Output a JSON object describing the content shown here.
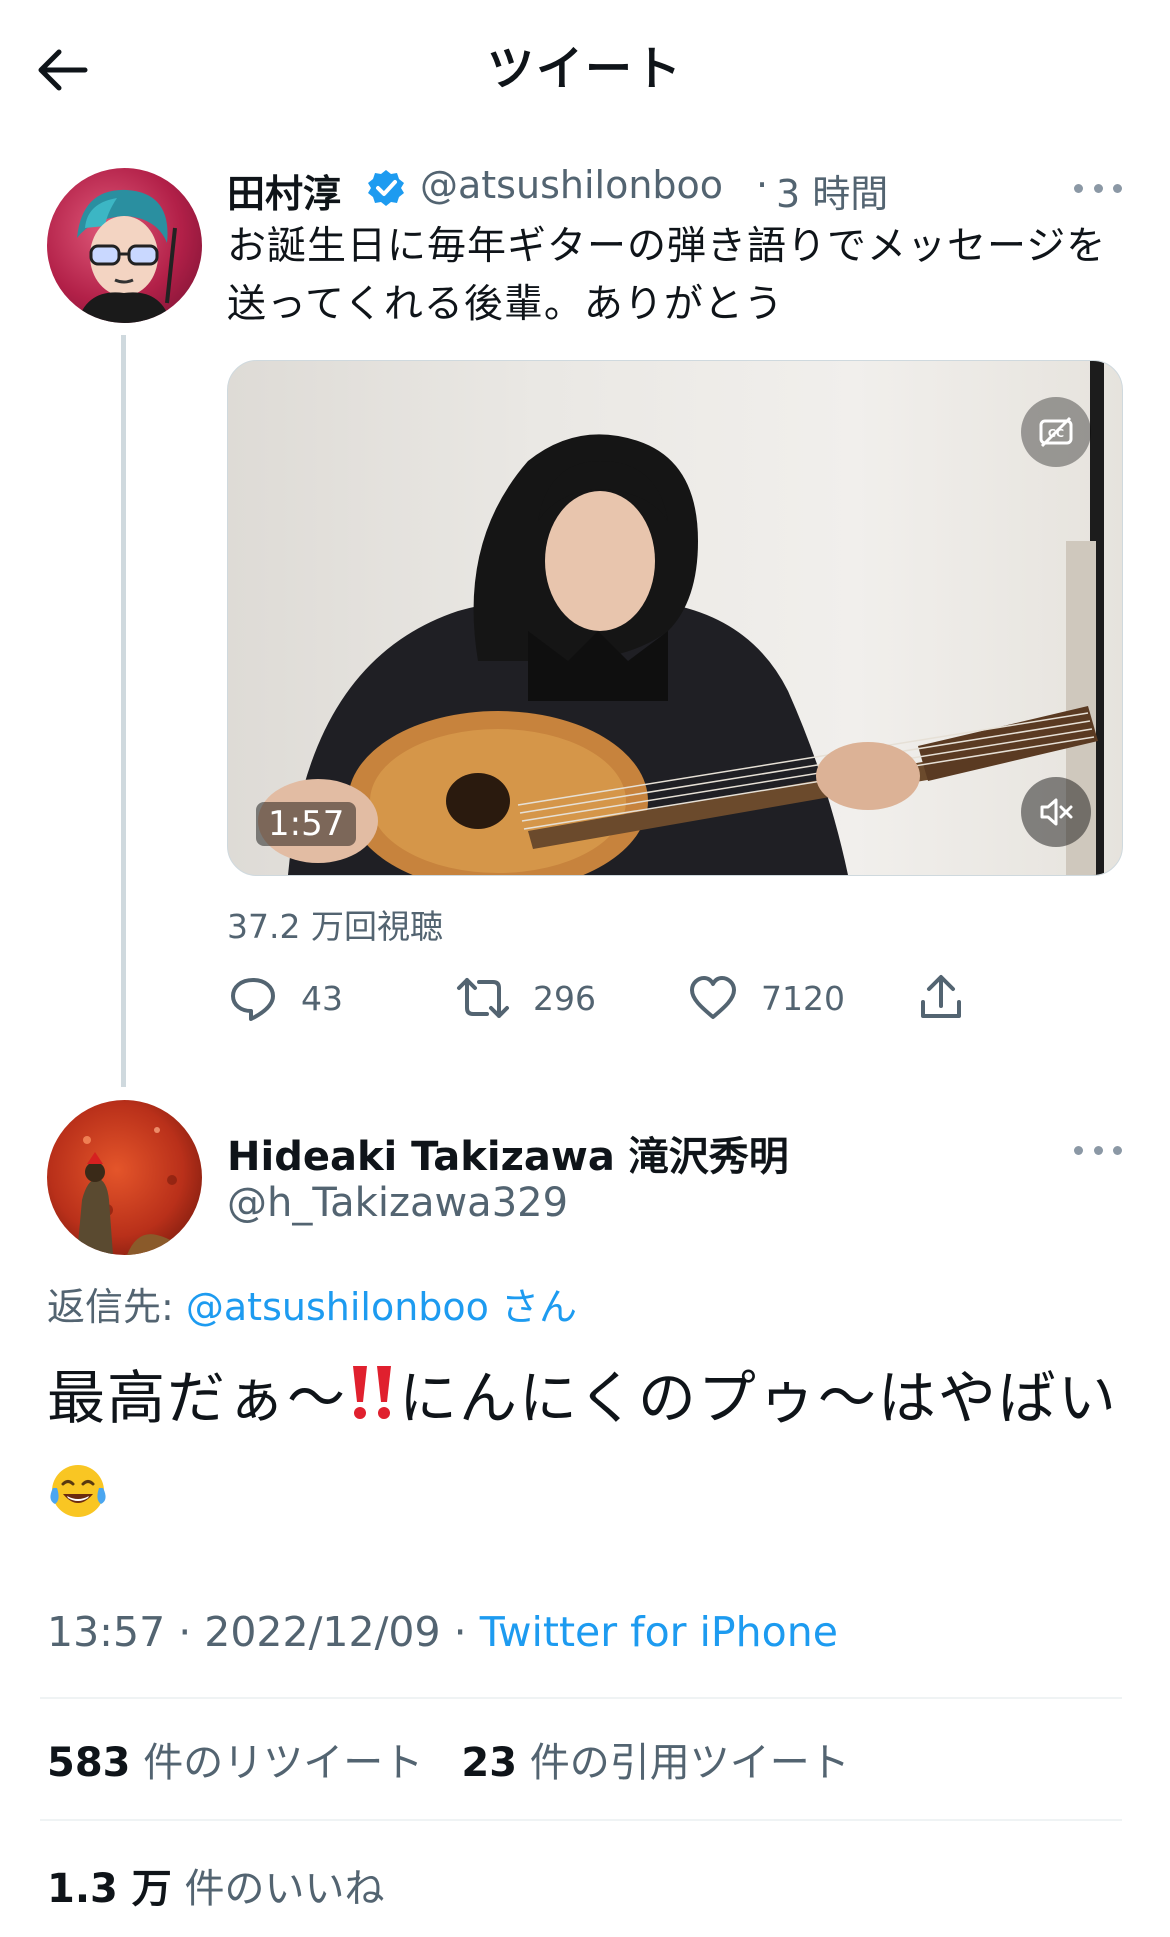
{
  "header": {
    "title": "ツイート"
  },
  "icons": {
    "back": "arrow-left-icon",
    "verified": "verified-badge-icon",
    "more": "more-horizontal-icon",
    "captions": "captions-off-icon",
    "mute": "volume-muted-icon",
    "reply": "reply-icon",
    "retweet": "retweet-icon",
    "like": "heart-icon",
    "share": "share-icon"
  },
  "colors": {
    "accent": "#1d9bf0",
    "secondary_text": "#536471",
    "primary_text": "#0f1419"
  },
  "parent_tweet": {
    "name": "田村淳",
    "handle": "@atsushilonboo",
    "dot": "·",
    "time": "3 時間",
    "text": "お誕生日に毎年ギターの弾き語りでメッセージを送ってくれる後輩。ありがとう",
    "video": {
      "duration": "1:57"
    },
    "views": "37.2 万回視聴",
    "replies": "43",
    "retweets": "296",
    "likes": "7120"
  },
  "reply_tweet": {
    "name": "Hideaki Takizawa 滝沢秀明",
    "handle": "@h_Takizawa329",
    "reply_to_label": "返信先: ",
    "reply_to_handle": "@atsushilonboo",
    "reply_to_suffix": " さん",
    "text_part1": "最高だぁ～",
    "text_part2": "にんにくのプゥ～はやばい",
    "time": "13:57",
    "date": "2022/12/09",
    "sep": " · ",
    "source": "Twitter for iPhone",
    "stats": {
      "retweets_count": "583",
      "retweets_label": " 件のリツイート",
      "quotes_count": "23",
      "quotes_label": " 件の引用ツイート",
      "likes_count": "1.3 万",
      "likes_label": " 件のいいね"
    }
  }
}
